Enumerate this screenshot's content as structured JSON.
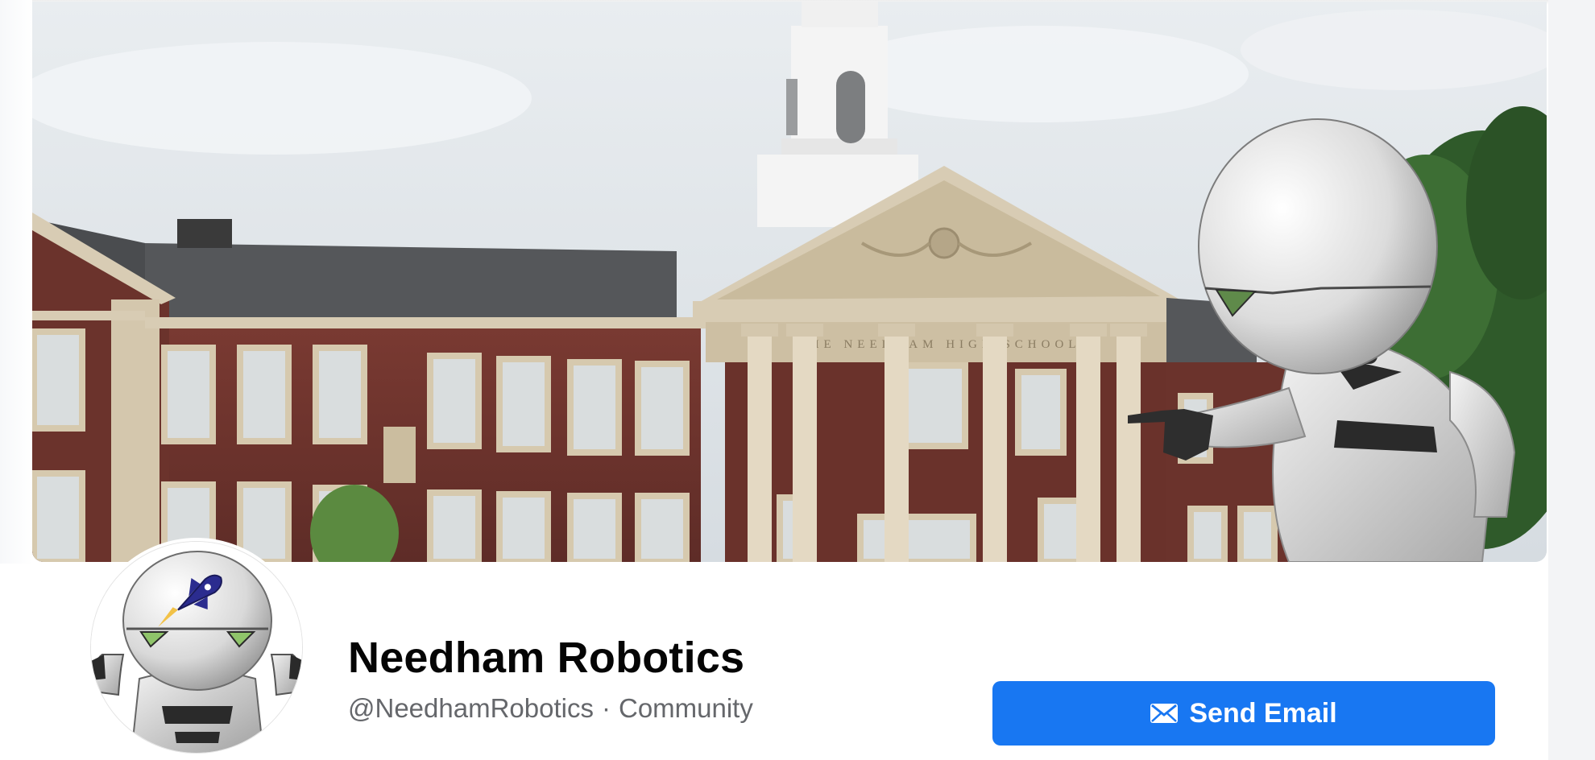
{
  "profile": {
    "name": "Needham Robotics",
    "handle": "@NeedhamRobotics",
    "separator": "·",
    "category": "Community"
  },
  "cover": {
    "building_inscription": "THE NEEDHAM HIGH SCHOOL"
  },
  "actions": {
    "send_email_label": "Send Email",
    "send_email_icon": "envelope-icon"
  },
  "colors": {
    "accent": "#1877f2",
    "name_text": "#050505",
    "secondary_text": "#65676b"
  }
}
